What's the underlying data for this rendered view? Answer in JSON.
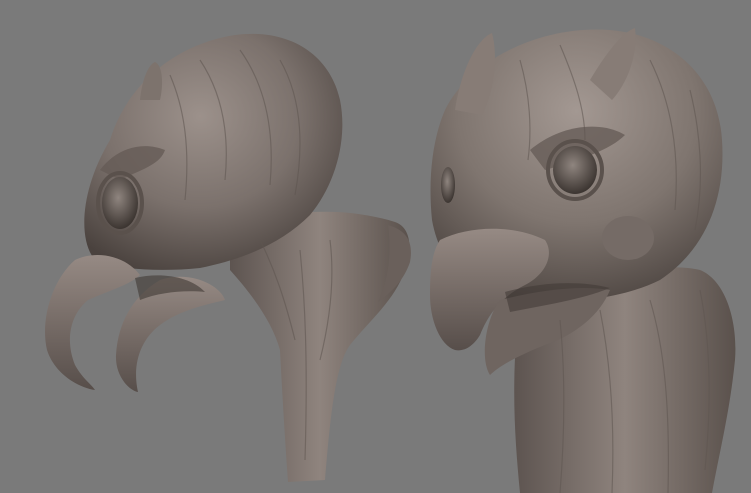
{
  "scene": {
    "background_color": "#7a7a7a",
    "clay_color": "#7b716c",
    "clay_highlight": "#a0958f",
    "clay_shadow": "#3f3834",
    "subjects": [
      {
        "label": "bird-bust-side-view"
      },
      {
        "label": "bird-bust-three-quarter-view"
      }
    ]
  }
}
